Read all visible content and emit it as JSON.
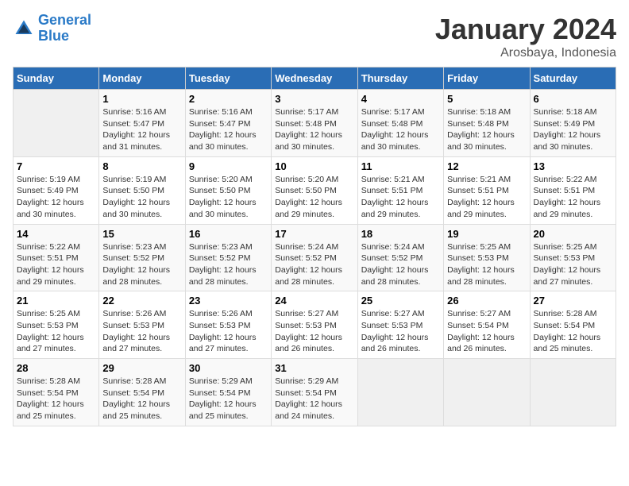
{
  "logo": {
    "text_general": "General",
    "text_blue": "Blue"
  },
  "header": {
    "title": "January 2024",
    "subtitle": "Arosbaya, Indonesia"
  },
  "weekdays": [
    "Sunday",
    "Monday",
    "Tuesday",
    "Wednesday",
    "Thursday",
    "Friday",
    "Saturday"
  ],
  "weeks": [
    [
      {
        "day": "",
        "sunrise": "",
        "sunset": "",
        "daylight": ""
      },
      {
        "day": "1",
        "sunrise": "Sunrise: 5:16 AM",
        "sunset": "Sunset: 5:47 PM",
        "daylight": "Daylight: 12 hours and 31 minutes."
      },
      {
        "day": "2",
        "sunrise": "Sunrise: 5:16 AM",
        "sunset": "Sunset: 5:47 PM",
        "daylight": "Daylight: 12 hours and 30 minutes."
      },
      {
        "day": "3",
        "sunrise": "Sunrise: 5:17 AM",
        "sunset": "Sunset: 5:48 PM",
        "daylight": "Daylight: 12 hours and 30 minutes."
      },
      {
        "day": "4",
        "sunrise": "Sunrise: 5:17 AM",
        "sunset": "Sunset: 5:48 PM",
        "daylight": "Daylight: 12 hours and 30 minutes."
      },
      {
        "day": "5",
        "sunrise": "Sunrise: 5:18 AM",
        "sunset": "Sunset: 5:48 PM",
        "daylight": "Daylight: 12 hours and 30 minutes."
      },
      {
        "day": "6",
        "sunrise": "Sunrise: 5:18 AM",
        "sunset": "Sunset: 5:49 PM",
        "daylight": "Daylight: 12 hours and 30 minutes."
      }
    ],
    [
      {
        "day": "7",
        "sunrise": "Sunrise: 5:19 AM",
        "sunset": "Sunset: 5:49 PM",
        "daylight": "Daylight: 12 hours and 30 minutes."
      },
      {
        "day": "8",
        "sunrise": "Sunrise: 5:19 AM",
        "sunset": "Sunset: 5:50 PM",
        "daylight": "Daylight: 12 hours and 30 minutes."
      },
      {
        "day": "9",
        "sunrise": "Sunrise: 5:20 AM",
        "sunset": "Sunset: 5:50 PM",
        "daylight": "Daylight: 12 hours and 30 minutes."
      },
      {
        "day": "10",
        "sunrise": "Sunrise: 5:20 AM",
        "sunset": "Sunset: 5:50 PM",
        "daylight": "Daylight: 12 hours and 29 minutes."
      },
      {
        "day": "11",
        "sunrise": "Sunrise: 5:21 AM",
        "sunset": "Sunset: 5:51 PM",
        "daylight": "Daylight: 12 hours and 29 minutes."
      },
      {
        "day": "12",
        "sunrise": "Sunrise: 5:21 AM",
        "sunset": "Sunset: 5:51 PM",
        "daylight": "Daylight: 12 hours and 29 minutes."
      },
      {
        "day": "13",
        "sunrise": "Sunrise: 5:22 AM",
        "sunset": "Sunset: 5:51 PM",
        "daylight": "Daylight: 12 hours and 29 minutes."
      }
    ],
    [
      {
        "day": "14",
        "sunrise": "Sunrise: 5:22 AM",
        "sunset": "Sunset: 5:51 PM",
        "daylight": "Daylight: 12 hours and 29 minutes."
      },
      {
        "day": "15",
        "sunrise": "Sunrise: 5:23 AM",
        "sunset": "Sunset: 5:52 PM",
        "daylight": "Daylight: 12 hours and 28 minutes."
      },
      {
        "day": "16",
        "sunrise": "Sunrise: 5:23 AM",
        "sunset": "Sunset: 5:52 PM",
        "daylight": "Daylight: 12 hours and 28 minutes."
      },
      {
        "day": "17",
        "sunrise": "Sunrise: 5:24 AM",
        "sunset": "Sunset: 5:52 PM",
        "daylight": "Daylight: 12 hours and 28 minutes."
      },
      {
        "day": "18",
        "sunrise": "Sunrise: 5:24 AM",
        "sunset": "Sunset: 5:52 PM",
        "daylight": "Daylight: 12 hours and 28 minutes."
      },
      {
        "day": "19",
        "sunrise": "Sunrise: 5:25 AM",
        "sunset": "Sunset: 5:53 PM",
        "daylight": "Daylight: 12 hours and 28 minutes."
      },
      {
        "day": "20",
        "sunrise": "Sunrise: 5:25 AM",
        "sunset": "Sunset: 5:53 PM",
        "daylight": "Daylight: 12 hours and 27 minutes."
      }
    ],
    [
      {
        "day": "21",
        "sunrise": "Sunrise: 5:25 AM",
        "sunset": "Sunset: 5:53 PM",
        "daylight": "Daylight: 12 hours and 27 minutes."
      },
      {
        "day": "22",
        "sunrise": "Sunrise: 5:26 AM",
        "sunset": "Sunset: 5:53 PM",
        "daylight": "Daylight: 12 hours and 27 minutes."
      },
      {
        "day": "23",
        "sunrise": "Sunrise: 5:26 AM",
        "sunset": "Sunset: 5:53 PM",
        "daylight": "Daylight: 12 hours and 27 minutes."
      },
      {
        "day": "24",
        "sunrise": "Sunrise: 5:27 AM",
        "sunset": "Sunset: 5:53 PM",
        "daylight": "Daylight: 12 hours and 26 minutes."
      },
      {
        "day": "25",
        "sunrise": "Sunrise: 5:27 AM",
        "sunset": "Sunset: 5:53 PM",
        "daylight": "Daylight: 12 hours and 26 minutes."
      },
      {
        "day": "26",
        "sunrise": "Sunrise: 5:27 AM",
        "sunset": "Sunset: 5:54 PM",
        "daylight": "Daylight: 12 hours and 26 minutes."
      },
      {
        "day": "27",
        "sunrise": "Sunrise: 5:28 AM",
        "sunset": "Sunset: 5:54 PM",
        "daylight": "Daylight: 12 hours and 25 minutes."
      }
    ],
    [
      {
        "day": "28",
        "sunrise": "Sunrise: 5:28 AM",
        "sunset": "Sunset: 5:54 PM",
        "daylight": "Daylight: 12 hours and 25 minutes."
      },
      {
        "day": "29",
        "sunrise": "Sunrise: 5:28 AM",
        "sunset": "Sunset: 5:54 PM",
        "daylight": "Daylight: 12 hours and 25 minutes."
      },
      {
        "day": "30",
        "sunrise": "Sunrise: 5:29 AM",
        "sunset": "Sunset: 5:54 PM",
        "daylight": "Daylight: 12 hours and 25 minutes."
      },
      {
        "day": "31",
        "sunrise": "Sunrise: 5:29 AM",
        "sunset": "Sunset: 5:54 PM",
        "daylight": "Daylight: 12 hours and 24 minutes."
      },
      {
        "day": "",
        "sunrise": "",
        "sunset": "",
        "daylight": ""
      },
      {
        "day": "",
        "sunrise": "",
        "sunset": "",
        "daylight": ""
      },
      {
        "day": "",
        "sunrise": "",
        "sunset": "",
        "daylight": ""
      }
    ]
  ]
}
